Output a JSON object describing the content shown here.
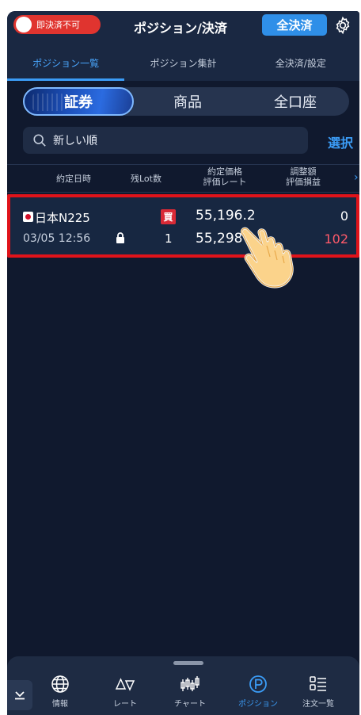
{
  "header": {
    "toggle_label": "即決済不可",
    "title": "ポジション/決済",
    "settle_all_label": "全決済"
  },
  "tabs": [
    {
      "label": "ポジション一覧",
      "active": true
    },
    {
      "label": "ポジション集計",
      "active": false
    },
    {
      "label": "全決済/設定",
      "active": false
    }
  ],
  "segments": [
    {
      "label": "証券",
      "active": true
    },
    {
      "label": "商品",
      "active": false
    },
    {
      "label": "全口座",
      "active": false
    }
  ],
  "search": {
    "sort_label": "新しい順",
    "select_label": "選択"
  },
  "columns": {
    "date": "約定日時",
    "lot": "残Lot数",
    "price_line1": "約定価格",
    "price_line2": "評価レート",
    "adjust_line1": "調整額",
    "adjust_line2": "評価損益",
    "more": "›"
  },
  "positions": [
    {
      "symbol": "日本N225",
      "datetime": "03/05 12:56",
      "side": "買",
      "lot": "1",
      "contract_price": "55,196.2",
      "eval_rate": "55,298",
      "adjust": "0",
      "pnl": "102"
    }
  ],
  "nav": [
    {
      "label": "情報",
      "icon": "globe-icon"
    },
    {
      "label": "レート",
      "icon": "rate-triangles-icon"
    },
    {
      "label": "チャート",
      "icon": "candlestick-icon"
    },
    {
      "label": "ポジション",
      "icon": "position-p-icon",
      "active": true
    },
    {
      "label": "注文一覧",
      "icon": "order-list-icon"
    }
  ],
  "colors": {
    "background": "#10192e",
    "accent": "#3b9cf6",
    "toggle_off": "#e0342f",
    "highlight_border": "#e0131a",
    "loss_profit_red": "#ff5a6a"
  }
}
